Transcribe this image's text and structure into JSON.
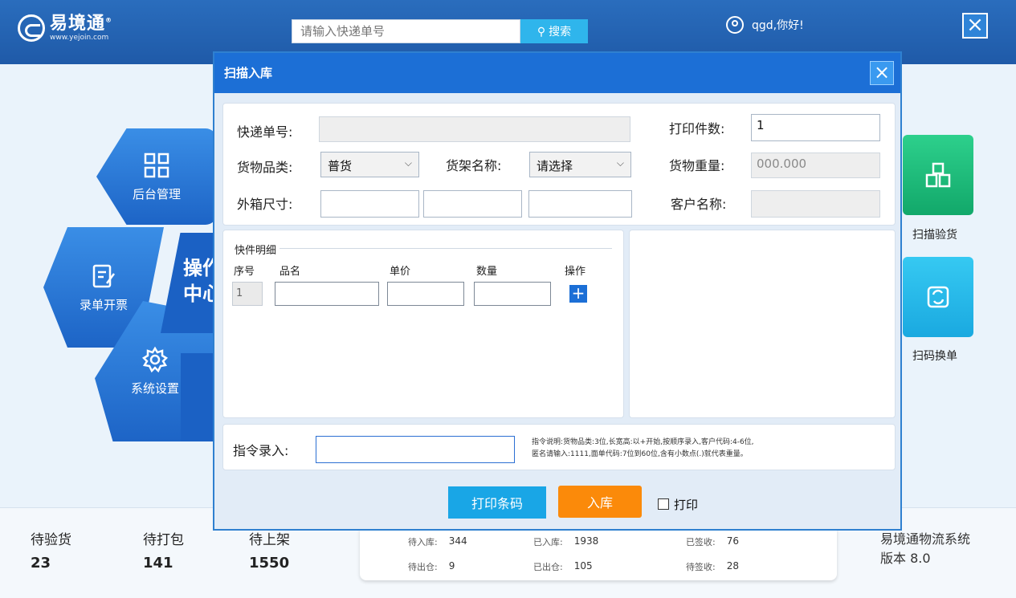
{
  "header": {
    "logo_cn": "易境通",
    "logo_url": "www.yejoin.com",
    "search_placeholder": "请输入快递单号",
    "search_btn": "搜索",
    "greeting": "qgd,你好!",
    "close": "×"
  },
  "nav": {
    "backend": "后台管理",
    "order": "录单开票",
    "settings": "系统设置",
    "center_line1": "操作",
    "center_line2": "中心",
    "scan_check": "扫描验货",
    "scan_swap": "扫码换单"
  },
  "stats": {
    "items": [
      {
        "label": "待验货",
        "value": "23"
      },
      {
        "label": "待打包",
        "value": "141"
      },
      {
        "label": "待上架",
        "value": "1550"
      }
    ],
    "mini": [
      {
        "label": "待入库:",
        "value": "344"
      },
      {
        "label": "已入库:",
        "value": "1938"
      },
      {
        "label": "已签收:",
        "value": "76"
      },
      {
        "label": "待出仓:",
        "value": "9"
      },
      {
        "label": "已出仓:",
        "value": "105"
      },
      {
        "label": "待签收:",
        "value": "28"
      }
    ],
    "system_name": "易境通物流系统",
    "version": "版本 8.0"
  },
  "modal": {
    "title": "扫描入库",
    "close": "×",
    "top": {
      "tracking_label": "快递单号:",
      "print_count_label": "打印件数:",
      "print_count_value": "1",
      "category_label": "货物品类:",
      "category_value": "普货",
      "shelf_label": "货架名称:",
      "shelf_value": "请选择",
      "weight_label": "货物重量:",
      "weight_value": "000.000",
      "size_label": "外箱尺寸:",
      "customer_label": "客户名称:"
    },
    "detail": {
      "title": "快件明细",
      "headers": [
        "序号",
        "品名",
        "单价",
        "数量",
        "操作"
      ],
      "row_no": "1",
      "add": "+"
    },
    "command": {
      "label": "指令录入:",
      "hint_line1": "指令说明:货物品类:3位,长宽高:以+开始,按顺序录入,客户代码:4-6位,",
      "hint_line2": "匿名请输入:1111,面单代码:7位到60位,含有小数点(.)就代表重量。"
    },
    "buttons": {
      "print_barcode": "打印条码",
      "store": "入库",
      "print_check": "打印"
    }
  }
}
